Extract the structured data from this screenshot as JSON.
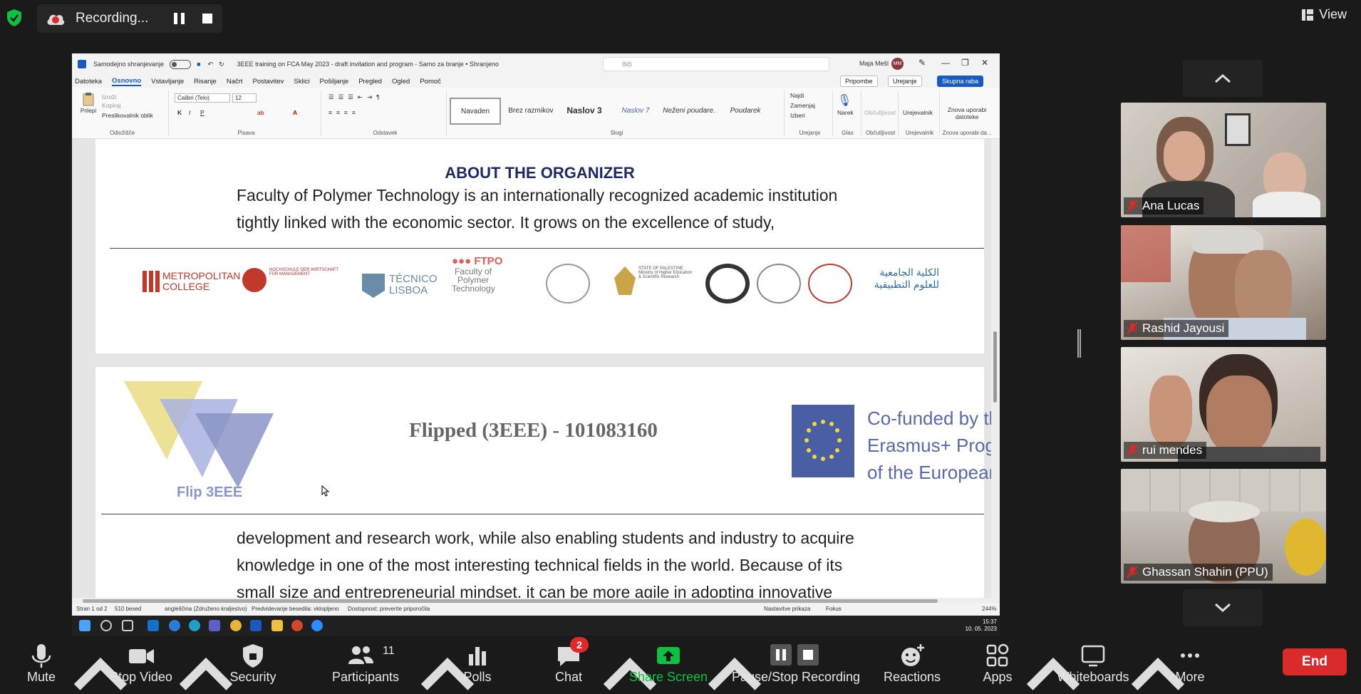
{
  "top_bar": {
    "recording_label": "Recording...",
    "view_label": "View"
  },
  "word": {
    "autosave_label": "Samodejno shranjevanje",
    "doc_title": "3EEE training on FCA May 2023 - draft invitation and program  -  Samo za branje  •  Shranjeno",
    "search_placeholder": "Išči",
    "user_name": "Maja Mešl",
    "user_initials": "MM",
    "menu": [
      "Datoteka",
      "Osnovno",
      "Vstavljanje",
      "Risanje",
      "Načrt",
      "Postavitev",
      "Sklici",
      "Pošiljanje",
      "Pregled",
      "Ogled",
      "Pomoč"
    ],
    "menu_active": "Osnovno",
    "comments_btn": "Pripombe",
    "editing_btn": "Urejanje",
    "share_btn": "Skupna raba",
    "ribbon": {
      "paste": "Prilepi",
      "cut": "Izreži",
      "copy": "Kopiraj",
      "format_painter": "Preslikovalnik oblik",
      "clipboard": "Odložišče",
      "font_name": "Calibri (Telo)",
      "font_size": "12",
      "font_group": "Pisava",
      "paragraph_group": "Odstavek",
      "styles": [
        "Navaden",
        "Brez razmikov",
        "Naslov 3",
        "Naslov 7",
        "Neženi poudare.",
        "Poudarek"
      ],
      "styles_group": "Slogi",
      "find": "Najdi",
      "replace": "Zamenjaj",
      "select": "Izberi",
      "editing_group": "Urejanje",
      "dictate": "Narek",
      "voice_group": "Glas",
      "sensitivity": "Občutljivost",
      "sensitivity_group": "Občutljivost",
      "editor": "Urejevalnik",
      "editor_group": "Urejevalnik",
      "reuse": "Znova uporabi datoteke",
      "reuse_group": "Znova uporabi da..."
    },
    "page1": {
      "heading": "ABOUT THE ORGANIZER",
      "line1": "Faculty of Polymer Technology is an internationally recognized academic institution",
      "line2": "tightly linked with the economic sector. It grows on the excellence of study,",
      "logos": {
        "metropolitan": "METROPOLITAN COLLEGE",
        "hochschule": "HOCHSCHULE DER WIRTSCHAFT FÜR MANAGEMENT",
        "tecnico": "TÉCNICO LISBOA",
        "ftpo": "FTPO",
        "ftpo_sub": "Faculty of Polymer Technology",
        "palestine": "STATE OF PALESTINE Ministry of Higher Education & Scientific Research",
        "arabic": "الكلية الجامعية للعلوم التطبيقية"
      }
    },
    "page2": {
      "flip_label": "Flip 3EEE",
      "project_title": "Flipped (3EEE) - 101083160",
      "eu_line1": "Co-funded by the",
      "eu_line2": "Erasmus+ Programme",
      "eu_line3": "of the European Union",
      "body1": "development and research work, while also enabling students and industry to acquire",
      "body2": "knowledge in one of the most interesting technical fields in the world. Because of its",
      "body3": "small size and entrepreneurial mindset, it can be more agile in adopting innovative"
    },
    "status": {
      "page": "Stran 1 od 2",
      "words": "510 besed",
      "language": "angleščina (Združeno kraljestvo)",
      "prediction": "Predvidevanje besedila: vklopljeno",
      "accessibility": "Dostopnost: preverite priporočila",
      "display_settings": "Nastavitve prikaza",
      "focus": "Fokus",
      "zoom": "244%"
    },
    "clock_time": "15:37",
    "clock_date": "10. 05. 2023"
  },
  "participants": [
    {
      "name": "Ana Lucas",
      "bg": "#b9b4ad"
    },
    {
      "name": "Rashid Jayousi",
      "bg": "#7d6e63"
    },
    {
      "name": "rui mendes",
      "bg": "#b7a99c"
    },
    {
      "name": "Ghassan Shahin (PPU)",
      "bg": "#a19a91"
    }
  ],
  "toolbar": {
    "mute": "Mute",
    "stop_video": "Stop Video",
    "security": "Security",
    "participants": "Participants",
    "participants_count": "11",
    "polls": "Polls",
    "chat": "Chat",
    "chat_badge": "2",
    "share_screen": "Share Screen",
    "pause_stop": "Pause/Stop Recording",
    "reactions": "Reactions",
    "apps": "Apps",
    "whiteboards": "Whiteboards",
    "more": "More",
    "end": "End"
  },
  "colors": {
    "accent_green": "#0dc143",
    "end_red": "#d92b2b",
    "word_blue": "#185abd"
  }
}
